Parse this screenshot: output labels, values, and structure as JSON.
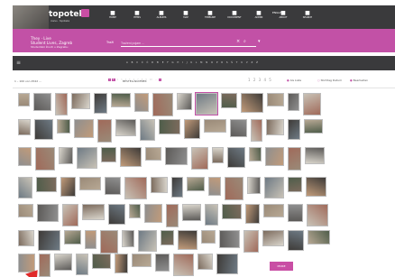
{
  "header": {
    "logo_text": "topoteka",
    "logo_sub": "icarus · topoteka",
    "nav": [
      {
        "label": "HOME",
        "icon": "home-icon"
      },
      {
        "label": "ITEMS",
        "icon": "items-icon"
      },
      {
        "label": "ALBUMS",
        "icon": "albums-icon"
      },
      {
        "label": "MAP",
        "icon": "map-icon"
      },
      {
        "label": "TIMELINE",
        "icon": "timeline-icon"
      },
      {
        "label": "DOCUMENT",
        "icon": "document-icon"
      },
      {
        "label": "ADMIN",
        "icon": "admin-icon"
      },
      {
        "label": "ABOUT",
        "icon": "about-icon"
      },
      {
        "label": "SEARCH",
        "icon": "search-icon"
      }
    ],
    "lang": "ENGLISH"
  },
  "band": {
    "title_line1": "They · Live",
    "title_line2": "Student Lives, Zagreb",
    "title_sub": "Studentski životi u Zagrebu",
    "search_label": "Traži",
    "search_placeholder": "Traženi pojam ..."
  },
  "filters": {
    "alphabet": "A B C Ć Č D Đ E F G H I J K L M N O P R S Š T U V Z Ž",
    "pages": [
      "‹",
      "1",
      "2",
      "3",
      "4",
      "5",
      "6",
      "7",
      "8",
      "9",
      "10",
      "…",
      "›"
    ],
    "results_info": "1 – 100 von 2542 ...",
    "sort_info": "BESTELLNUMMER",
    "pager_dots": "1 2 3 4 5",
    "opt1": "Als Liste",
    "opt2": "Stichtag Datum",
    "opt3": "Bearbeiten"
  },
  "load_more": "MORE"
}
